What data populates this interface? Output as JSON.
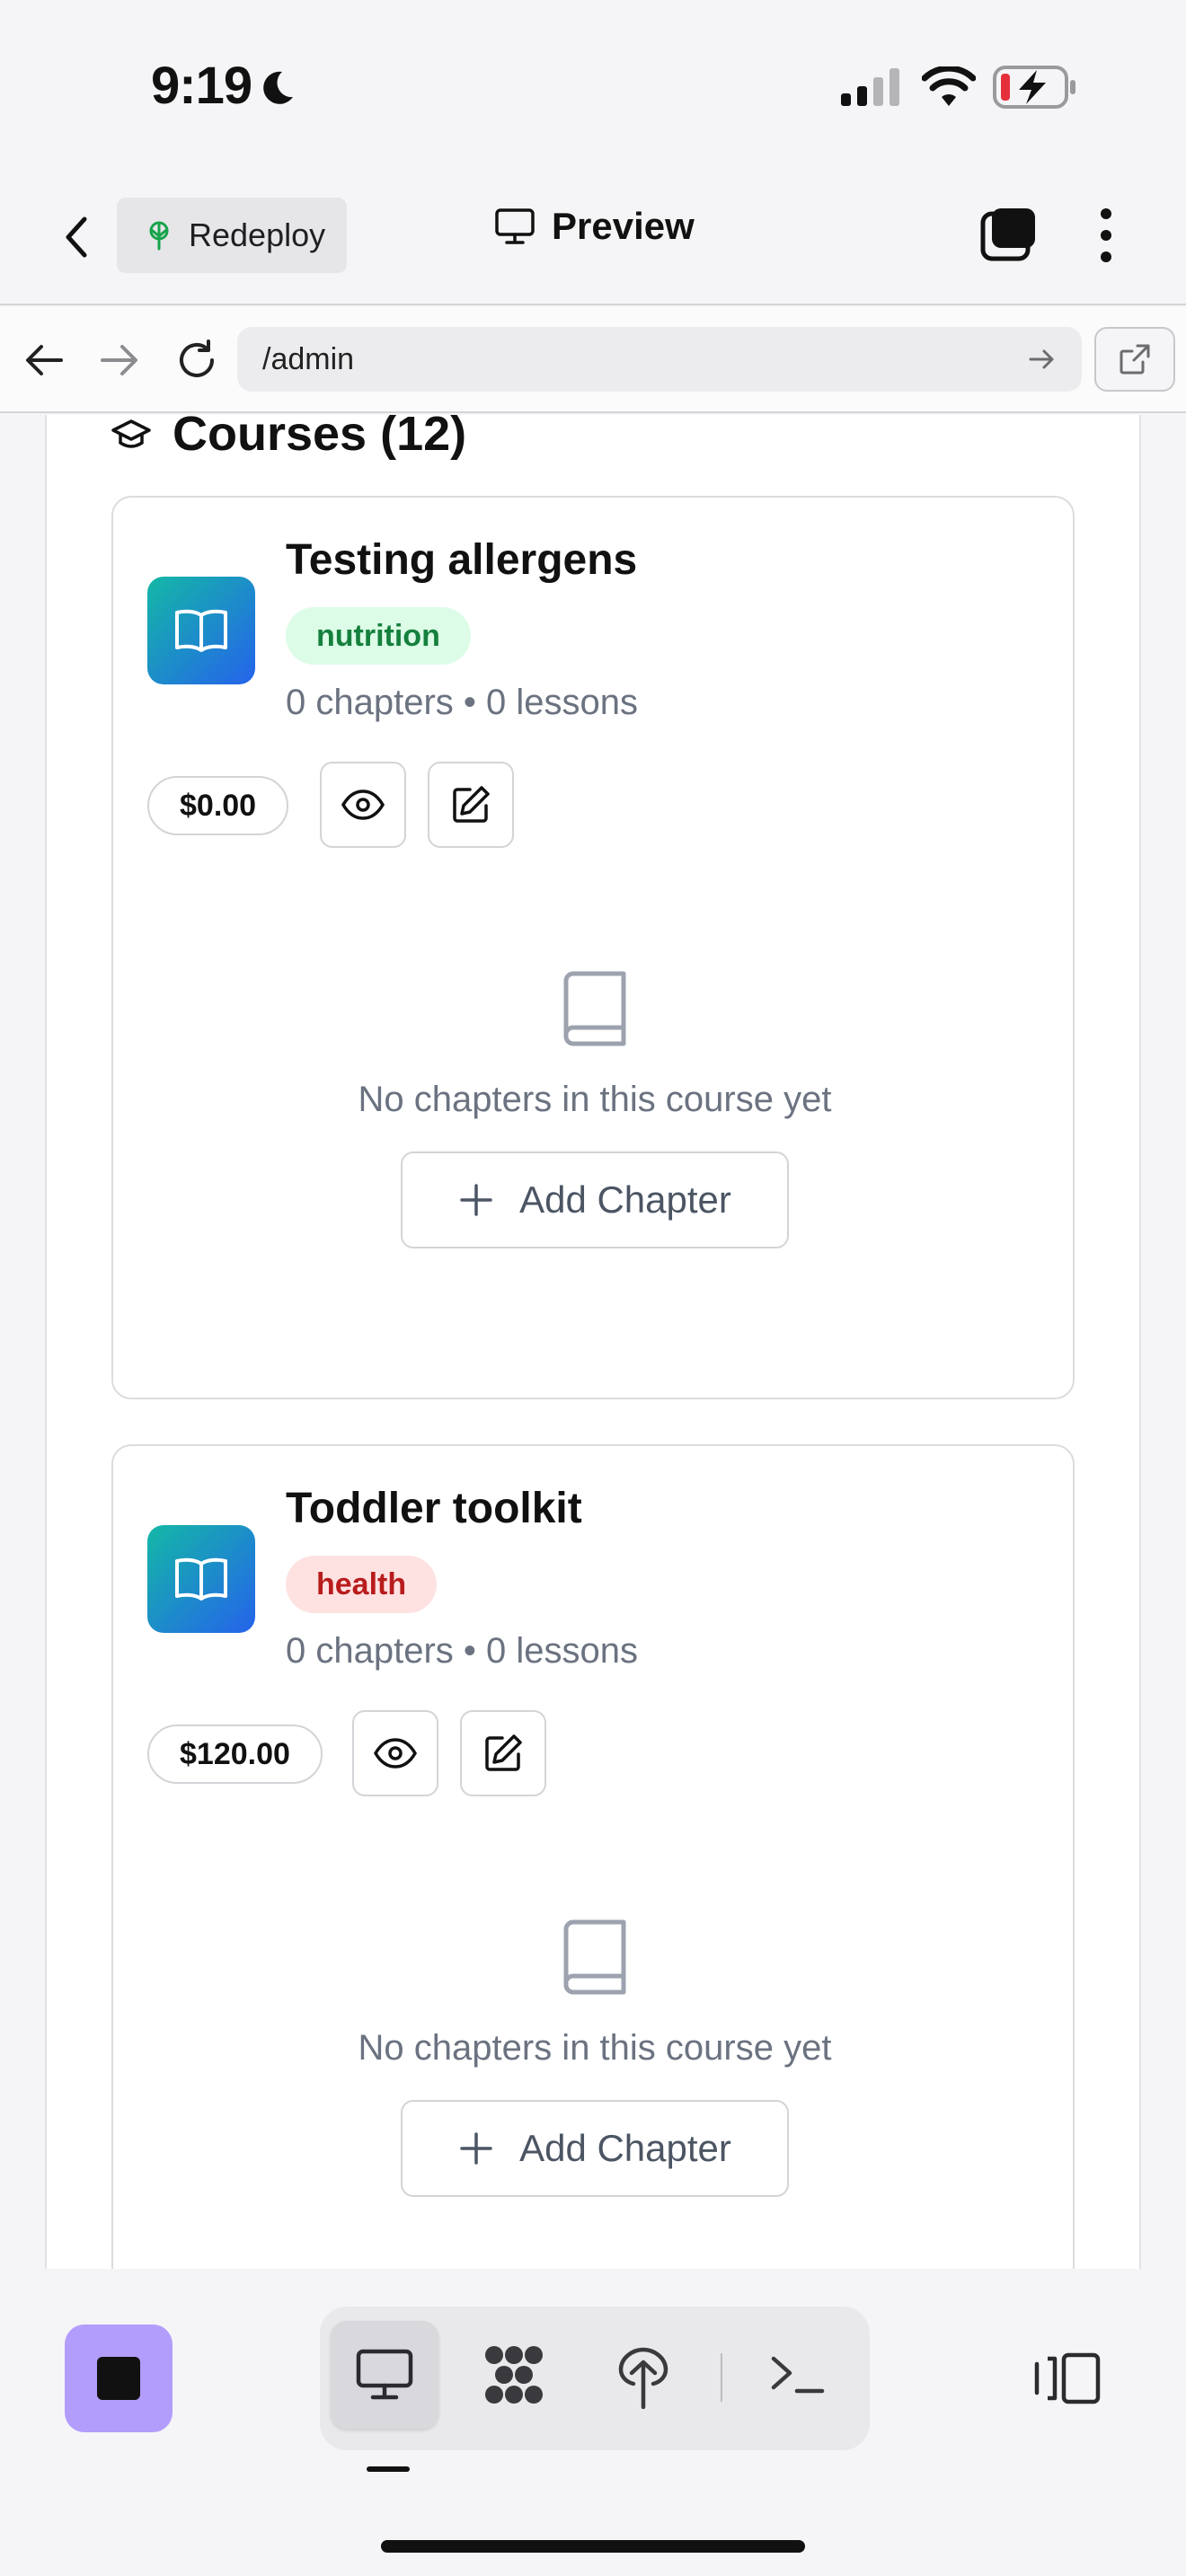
{
  "status_bar": {
    "time": "9:19"
  },
  "top_bar": {
    "redeploy_label": "Redeploy",
    "preview_label": "Preview"
  },
  "url_bar": {
    "url": "/admin"
  },
  "section": {
    "title": "Courses (12)"
  },
  "courses": [
    {
      "title": "Testing allergens",
      "tag": "nutrition",
      "tag_bg": "#dcfce7",
      "tag_color": "#15803d",
      "meta": "0 chapters • 0 lessons",
      "price": "$0.00",
      "empty_text": "No chapters in this course yet",
      "add_label": "Add Chapter"
    },
    {
      "title": "Toddler toolkit",
      "tag": "health",
      "tag_bg": "#fee2e2",
      "tag_color": "#b91c1c",
      "meta": "0 chapters • 0 lessons",
      "price": "$120.00",
      "empty_text": "No chapters in this course yet",
      "add_label": "Add Chapter"
    }
  ],
  "colors": {
    "accent_purple": "#b39dfc",
    "icon_gradient_start": "#14b8a6",
    "icon_gradient_end": "#2563eb"
  }
}
